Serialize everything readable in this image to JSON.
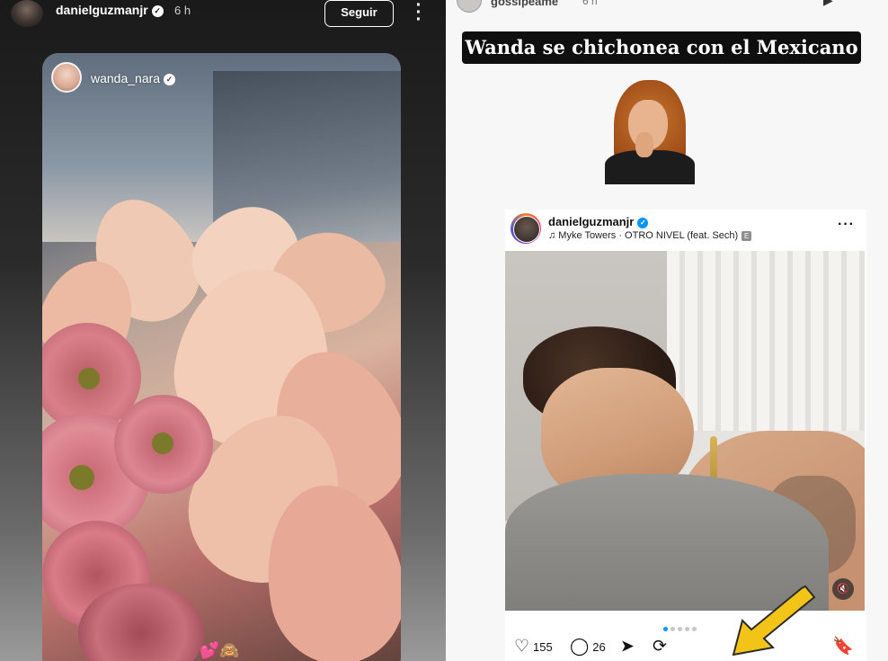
{
  "left_story": {
    "username": "danielguzmanjr",
    "time": "6 h",
    "follow_label": "Seguir",
    "more_icon": "more-vertical-icon",
    "shared_post": {
      "username": "wanda_nara",
      "stickers": "💕🙈"
    }
  },
  "right_story": {
    "username": "gossipeame",
    "time": "6 h",
    "headline": "Wanda se chichonea con el Mexicano",
    "post": {
      "username": "danielguzmanjr",
      "music": "♫ Myke Towers · OTRO NIVEL (feat. Sech)",
      "explicit": "E",
      "likes": "155",
      "comments": "26",
      "carousel_dots": 5,
      "active_dot": 0
    }
  },
  "colors": {
    "accent_blue": "#0095f6",
    "headline_bg": "#0f0f0f",
    "arrow_yellow": "#f2c418"
  }
}
